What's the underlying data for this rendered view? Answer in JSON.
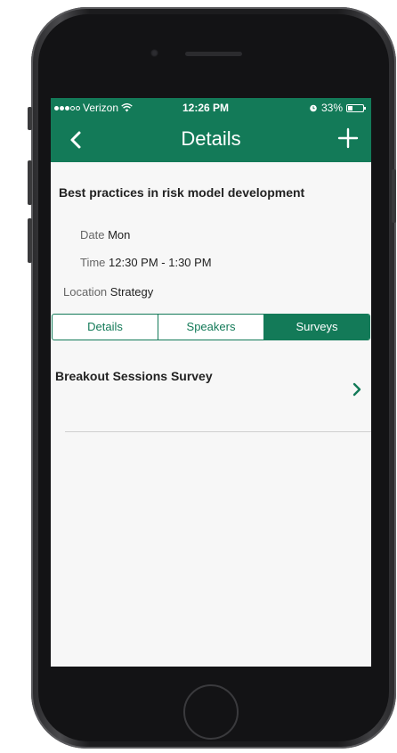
{
  "colors": {
    "brand_green": "#137a58",
    "screen_background": "#f7f7f7"
  },
  "status_bar": {
    "carrier": "Verizon",
    "time": "12:26 PM",
    "battery": "33%",
    "battery_level": 0.33,
    "icons": [
      "signal-dots-icon",
      "wifi-icon",
      "alarm-icon",
      "battery-icon"
    ]
  },
  "nav": {
    "title": "Details",
    "back_icon": "chevron-left-icon",
    "add_icon": "plus-icon"
  },
  "session": {
    "title": "Best practices in risk model development",
    "date_label": "Date",
    "date_value": "Mon",
    "time_label": "Time",
    "time_value": "12:30 PM - 1:30 PM",
    "location_label": "Location",
    "location_value": "Strategy"
  },
  "tabs": [
    {
      "label": "Details",
      "active": false
    },
    {
      "label": "Speakers",
      "active": false
    },
    {
      "label": "Surveys",
      "active": true
    }
  ],
  "surveys": [
    {
      "title": "Breakout Sessions Survey",
      "icon": "chevron-right-icon"
    }
  ]
}
